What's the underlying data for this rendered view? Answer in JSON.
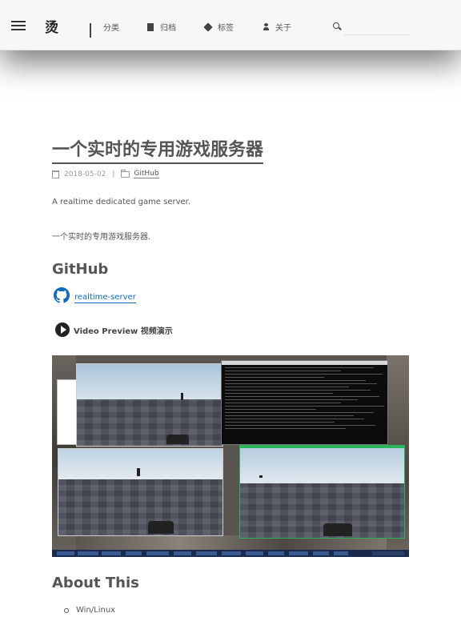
{
  "header": {
    "brand": "烫",
    "nav": [
      {
        "label": "分类",
        "icon": "grid-icon"
      },
      {
        "label": "归档",
        "icon": "archive-icon"
      },
      {
        "label": "标签",
        "icon": "tag-icon"
      },
      {
        "label": "关于",
        "icon": "user-icon"
      }
    ],
    "search": {
      "value": "",
      "placeholder": ""
    }
  },
  "post": {
    "title": "一个实时的专用游戏服务器",
    "date": "2018-05-02",
    "separator": "|",
    "category": "GitHub",
    "intro_en": "A realtime dedicated game server.",
    "intro_zh": "一个实时的专用游戏服务器.",
    "github_heading": "GitHub",
    "github_link": "realtime-server",
    "video_label": "Video Preview 视频演示",
    "about_heading": "About This",
    "about_items": [
      "Win/Linux"
    ]
  },
  "colors": {
    "link": "#0e6cbf",
    "text": "#555555",
    "header_bg": "#f7f7f7"
  }
}
